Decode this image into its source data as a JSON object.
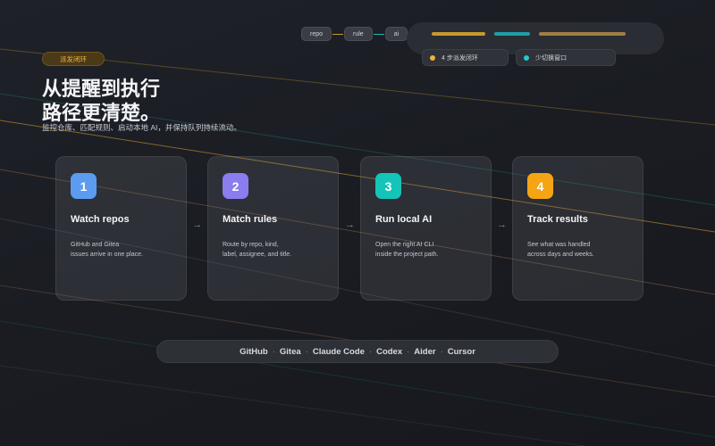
{
  "flow": {
    "nodes": [
      "repo",
      "rule",
      "ai"
    ],
    "connector_colors": [
      "#c79a2e",
      "#1fb8b0"
    ]
  },
  "progress": {
    "bar_colors": [
      "#c79a2e",
      "#1f9eaa",
      "#a07e45"
    ]
  },
  "chips": [
    {
      "label": "4 步派发闭环",
      "color": "#f0b340"
    },
    {
      "label": "少切换窗口",
      "color": "#22c7d6"
    }
  ],
  "tag": {
    "label": "派发闭环"
  },
  "hero": {
    "headline_line1": "从提醒到执行",
    "headline_line2": "路径更清楚。",
    "subtitle": "监控仓库、匹配规则、启动本地 AI，并保持队列持续流动。"
  },
  "steps": [
    {
      "number": "1",
      "title": "Watch repos",
      "desc_line1": "GitHub and Gitea",
      "desc_line2": "issues arrive in one place.",
      "badge_color": "#5b9cf0"
    },
    {
      "number": "2",
      "title": "Match rules",
      "desc_line1": "Route by repo, kind,",
      "desc_line2": "label, assignee, and title.",
      "badge_color": "#8b7cf0"
    },
    {
      "number": "3",
      "title": "Run local AI",
      "desc_line1": "Open the right AI CLI",
      "desc_line2": "inside the project path.",
      "badge_color": "#14c4b8"
    },
    {
      "number": "4",
      "title": "Track results",
      "desc_line1": "See what was handled",
      "desc_line2": "across days and weeks.",
      "badge_color": "#f5a513"
    }
  ],
  "arrows": [
    "→",
    "→",
    "→"
  ],
  "integrations": {
    "items": [
      "GitHub",
      "Gitea",
      "Claude Code",
      "Codex",
      "Aider",
      "Cursor"
    ],
    "separator": "·"
  }
}
